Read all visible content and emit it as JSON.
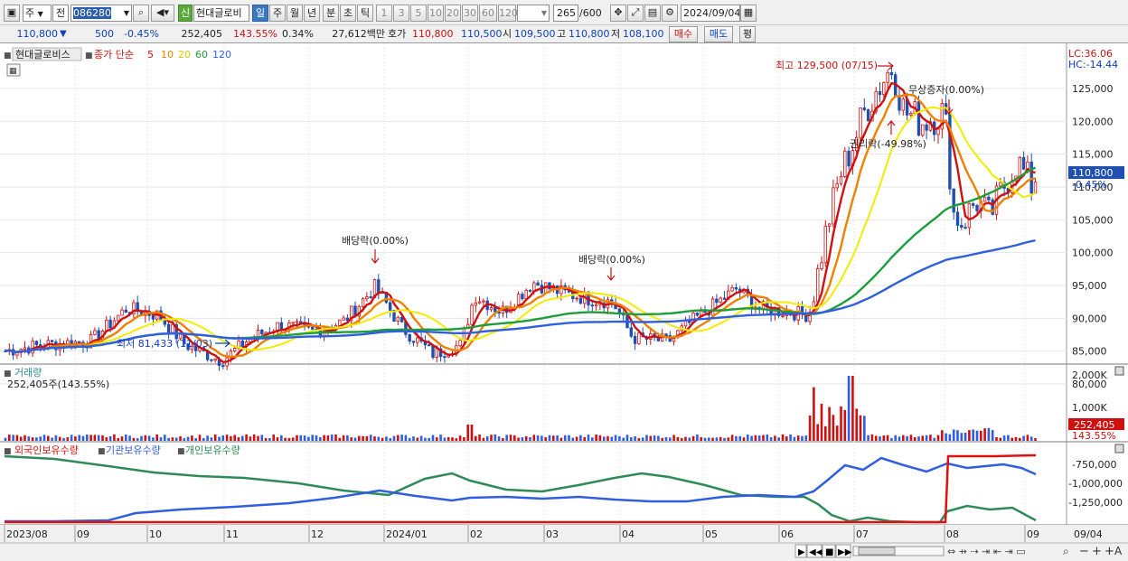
{
  "toolbar": {
    "market": "주",
    "mode": "전",
    "code": "086280",
    "new_badge": "신",
    "stock_name": "현대글로비",
    "periods": [
      "일",
      "주",
      "월",
      "년",
      "분",
      "초",
      "틱"
    ],
    "active_period": "일",
    "intervals": [
      "1",
      "3",
      "5",
      "10",
      "20",
      "30",
      "60",
      "120"
    ],
    "count": "265",
    "count_total": "/600",
    "date": "2024/09/04"
  },
  "quote": {
    "price": "110,800",
    "arrow": "▼",
    "change": "500",
    "change_pct": "-0.45%",
    "volume": "252,405",
    "volume_pct": "143.55%",
    "turnover_pct": "0.34%",
    "amount": "27,612백만",
    "hoga_label": "호가",
    "ask": "110,800",
    "bid": "110,500",
    "open_label": "시",
    "open": "109,500",
    "high_label": "고",
    "high": "110,800",
    "low_label": "저",
    "low": "108,100",
    "buy_label": "매수",
    "sell_label": "매도",
    "eval_label": "평"
  },
  "price_pane": {
    "legend_name": "현대글로비스",
    "legend_close": "종가 단순",
    "ma_periods": [
      "5",
      "10",
      "20",
      "60",
      "120"
    ],
    "ma_colors": [
      "#d01010",
      "#f08000",
      "#f2ec00",
      "#1e9e3a",
      "#2f5fe0"
    ],
    "lc": "LC:36.06",
    "hc": "HC:-14.44",
    "annotations": {
      "high": "최고 129,500 (07/15)",
      "low": "최저 81,433 (11/03)",
      "div1": "배당락(0.00%)",
      "div2": "배당락(0.00%)",
      "bonus": "무상증자(0.00%)",
      "rights": "권리락(-49.98%)"
    },
    "current_price_tag": "110,800",
    "current_change_tag": "-0.45%"
  },
  "volume_pane": {
    "title": "거래량",
    "readout": "252,405주(143.55%)",
    "y_ticks": [
      "2,000K",
      "1,000K"
    ],
    "tag": "252,405",
    "tag_pct": "143.55%"
  },
  "holdings_pane": {
    "series": [
      "외국인보유수량",
      "기관보유수량",
      "개인보유수량"
    ],
    "series_colors": [
      "#e01010",
      "#2f5fe0",
      "#2e8b57"
    ],
    "y_ticks": [
      "-750,000",
      "-1,000,000",
      "-1,250,000"
    ]
  },
  "x_axis": {
    "labels": [
      "2023/08",
      "09",
      "10",
      "11",
      "12",
      "2024/01",
      "02",
      "03",
      "04",
      "05",
      "06",
      "07",
      "08",
      "09"
    ],
    "right_label": "09/04"
  },
  "chart_data": {
    "type": "candlestick",
    "title": "현대글로비스",
    "y_ticks": [
      125000,
      120000,
      115000,
      110000,
      105000,
      100000,
      95000,
      90000,
      85000,
      80000
    ],
    "y_range": [
      78000,
      131500
    ],
    "x_range": [
      "2023/08",
      "2024/09/04"
    ],
    "key_values": {
      "high": 129500,
      "high_date": "07/15",
      "low": 81433,
      "low_date": "11/03",
      "last_close": 110800
    },
    "close_approx": [
      [
        "2023/08",
        85000
      ],
      [
        "2023/09",
        86500
      ],
      [
        "2023/10",
        89500
      ],
      [
        "2023/11",
        84000
      ],
      [
        "2023/12",
        88000
      ],
      [
        "2024/01",
        89000
      ],
      [
        "2024/01-late",
        84500
      ],
      [
        "2024/02",
        93000
      ],
      [
        "2024/03",
        95500
      ],
      [
        "2024/04",
        87000
      ],
      [
        "2024/05",
        93000
      ],
      [
        "2024/06",
        90500
      ],
      [
        "2024/07",
        124000
      ],
      [
        "2024/08",
        109000
      ],
      [
        "2024/09/04",
        110800
      ]
    ]
  }
}
